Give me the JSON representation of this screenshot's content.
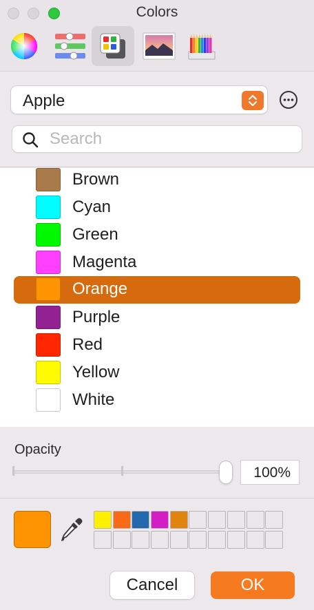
{
  "window": {
    "title": "Colors"
  },
  "toolbar": {
    "tools": [
      {
        "icon": "color-wheel-icon",
        "selected": false
      },
      {
        "icon": "color-sliders-icon",
        "selected": false
      },
      {
        "icon": "color-palettes-icon",
        "selected": true
      },
      {
        "icon": "image-palettes-icon",
        "selected": false
      },
      {
        "icon": "pencils-icon",
        "selected": false
      }
    ]
  },
  "palette_select": {
    "value": "Apple"
  },
  "search": {
    "placeholder": "Search",
    "value": ""
  },
  "color_list": {
    "items": [
      {
        "name": "Brown",
        "color": "#a97b4a",
        "selected": false
      },
      {
        "name": "Cyan",
        "color": "#00fdff",
        "selected": false
      },
      {
        "name": "Green",
        "color": "#00f900",
        "selected": false
      },
      {
        "name": "Magenta",
        "color": "#ff40ff",
        "selected": false
      },
      {
        "name": "Orange",
        "color": "#ff9300",
        "selected": true
      },
      {
        "name": "Purple",
        "color": "#942192",
        "selected": false
      },
      {
        "name": "Red",
        "color": "#ff2600",
        "selected": false
      },
      {
        "name": "Yellow",
        "color": "#fffb00",
        "selected": false
      },
      {
        "name": "White",
        "color": "#ffffff",
        "selected": false
      }
    ]
  },
  "opacity": {
    "label": "Opacity",
    "value_text": "100%",
    "value": 1.0
  },
  "current_color": "#fd9300",
  "saved_swatches": [
    "#fcf100",
    "#f86a16",
    "#2369ad",
    "#d21ec4",
    "#e0840f",
    null,
    null,
    null,
    null,
    null,
    null,
    null,
    null,
    null,
    null,
    null,
    null,
    null,
    null,
    null
  ],
  "buttons": {
    "cancel": "Cancel",
    "ok": "OK"
  },
  "accent_color": "#f57a20"
}
